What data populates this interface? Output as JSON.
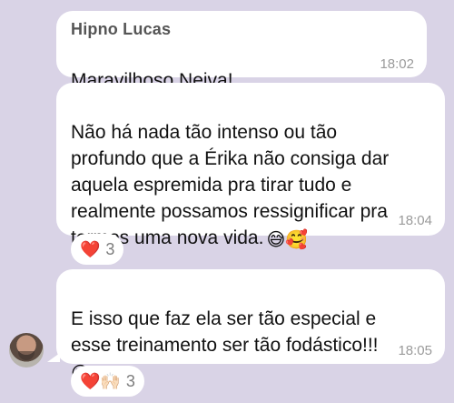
{
  "colors": {
    "background": "#d9d3e6",
    "bubble": "#ffffff",
    "text": "#111111",
    "sender": "#555555",
    "time": "#9a9a9a",
    "heart": "#e0243a"
  },
  "messages": [
    {
      "sender": "Hipno Lucas",
      "text": "Maravilhoso Neiva!",
      "emojis": "👏🏻👏🏻👏🏻",
      "time": "18:02"
    },
    {
      "text": "Não há nada tão intenso ou tão\nprofundo que a Érika não consiga dar\naquela espremida pra tirar tudo e\nrealmente possamos ressignificar pra\ntermos uma nova vida.",
      "emojis": "😅🥰",
      "time": "18:04",
      "reaction": {
        "emojis": "❤️",
        "count": "3"
      }
    },
    {
      "text": "E isso que faz ela ser tão especial e\nesse treinamento ser tão fodástico!!!",
      "emojis": "😁",
      "time": "18:05",
      "reaction": {
        "emojis": "❤️🙌🏻",
        "count": "3"
      }
    }
  ]
}
